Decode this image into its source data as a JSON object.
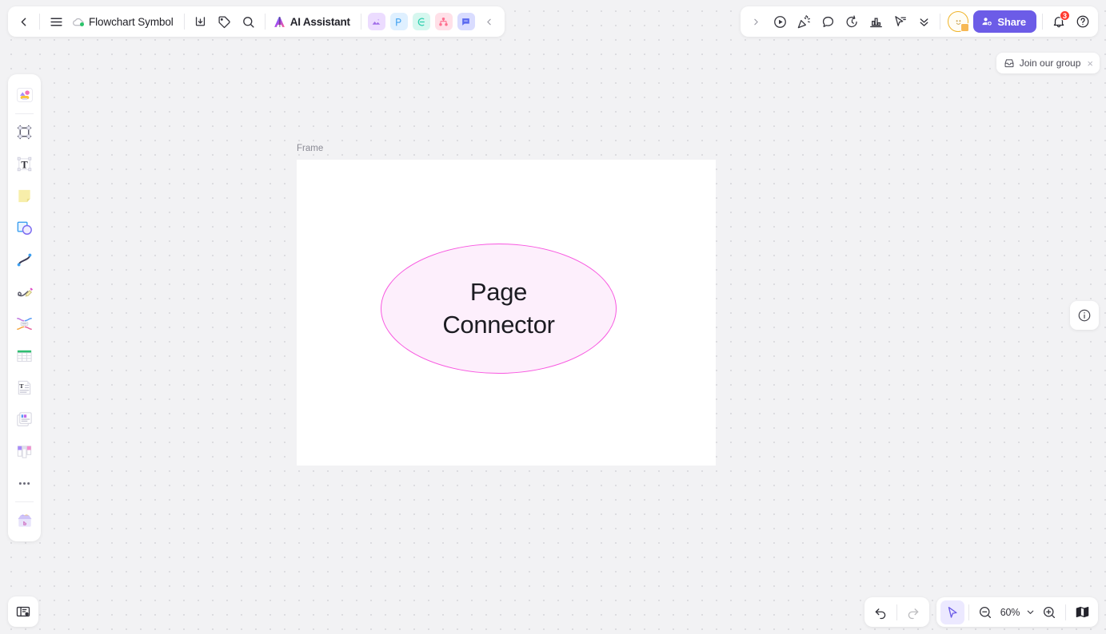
{
  "header": {
    "back_label": "Back",
    "menu_label": "Menu",
    "doc_title": "Flowchart Symbol",
    "cloud_status": "cloud-synced",
    "download_label": "Download",
    "tag_label": "Tag",
    "search_label": "Search",
    "ai_assistant_label": "AI Assistant",
    "app_icons": [
      {
        "name": "image-app-icon",
        "glyph": "image",
        "bg": "#ecdcff",
        "fg": "#a06ce8"
      },
      {
        "name": "presentation-app-icon",
        "glyph": "P",
        "bg": "#dff0ff",
        "fg": "#3ea0f0"
      },
      {
        "name": "mindmap-app-icon",
        "glyph": "C",
        "bg": "#d6f7ef",
        "fg": "#2fcfae"
      },
      {
        "name": "flowchart-app-icon",
        "glyph": "node",
        "bg": "#ffe0e8",
        "fg": "#ff6e8e"
      },
      {
        "name": "comment-app-icon",
        "glyph": "chat",
        "bg": "#d9dcff",
        "fg": "#5b6af0"
      }
    ],
    "collapse_left_label": "Collapse",
    "expand_right_label": "Expand",
    "right_tools": [
      {
        "name": "present-button",
        "label": "Present"
      },
      {
        "name": "celebrate-button",
        "label": "Celebrate"
      },
      {
        "name": "comment-button",
        "label": "Comment"
      },
      {
        "name": "timer-button",
        "label": "Timer"
      },
      {
        "name": "vote-button",
        "label": "Vote"
      },
      {
        "name": "cursor-chat-button",
        "label": "Cursor Chat"
      },
      {
        "name": "more-tools-button",
        "label": "More"
      }
    ],
    "share_label": "Share",
    "notifications_count": "3",
    "help_label": "Help"
  },
  "join_pill": {
    "label": "Join our group",
    "close_label": "×"
  },
  "left_toolbar": [
    {
      "name": "tool-templates",
      "label": "Templates"
    },
    {
      "name": "tool-frame",
      "label": "Frame"
    },
    {
      "name": "tool-text",
      "label": "Text"
    },
    {
      "name": "tool-sticky-note",
      "label": "Sticky Note"
    },
    {
      "name": "tool-shapes",
      "label": "Shapes"
    },
    {
      "name": "tool-connector",
      "label": "Connector"
    },
    {
      "name": "tool-pen",
      "label": "Pen"
    },
    {
      "name": "tool-mindmap",
      "label": "Mind Map"
    },
    {
      "name": "tool-table",
      "label": "Table"
    },
    {
      "name": "tool-document",
      "label": "Document"
    },
    {
      "name": "tool-card",
      "label": "Card"
    },
    {
      "name": "tool-kanban",
      "label": "Kanban"
    },
    {
      "name": "tool-more",
      "label": "More"
    },
    {
      "name": "tool-apps",
      "label": "Apps"
    }
  ],
  "bottom_left": {
    "name": "presentation-mode-button",
    "label": "Slides"
  },
  "canvas": {
    "frame_label": "Frame",
    "shape": {
      "type": "ellipse",
      "text_line1": "Page",
      "text_line2": "Connector",
      "fill": "#fdeffc",
      "stroke": "#f857e0"
    },
    "info_label": "Info"
  },
  "bottom_right": {
    "undo_label": "Undo",
    "redo_label": "Redo",
    "cursor_label": "Select",
    "zoom_out_label": "Zoom out",
    "zoom_level": "60%",
    "zoom_dropdown_label": "Zoom options",
    "zoom_in_label": "Zoom in",
    "minimap_label": "Minimap"
  }
}
